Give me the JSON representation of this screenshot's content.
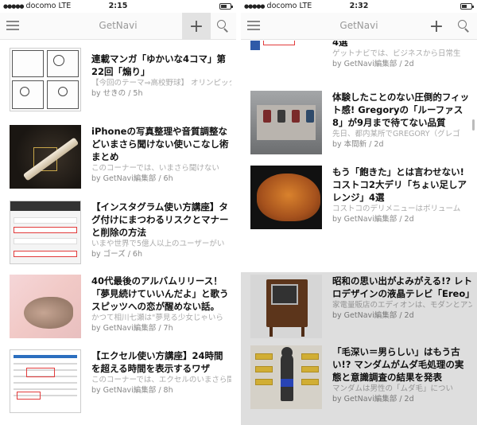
{
  "left": {
    "status": {
      "carrier": "docomo",
      "network": "LTE",
      "time": "2:15",
      "battery_level": 0.55
    },
    "nav": {
      "title": "GetNavi",
      "plus_label": "+"
    },
    "articles": [
      {
        "thumb": "manga-comic-thumbnail",
        "title": "連載マンガ「ゆかいな4コマ」第22回「煽り」",
        "excerpt": "【今回のテーマ⇒高校野球】 オリンピックとともに、夏の甲子園が終わっち",
        "meta": "by せきの / 5h"
      },
      {
        "thumb": "iphone-accessory-thumbnail",
        "title": "iPhoneの写真整理や音質調整などいまさら聞けない使いこなし術まとめ",
        "excerpt": "このコーナーでは、いまさら聞けない",
        "meta": "by GetNavi編集部 / 6h"
      },
      {
        "thumb": "instagram-settings-thumbnail",
        "title": "【インスタグラム使い方講座】タグ付けにまつわるリスクとマナーと削除の方法",
        "excerpt": "いまや世界で5億人以上のユーザーがい",
        "meta": "by ゴーズ / 6h"
      },
      {
        "thumb": "spitz-album-thumbnail",
        "title": "40代最後のアルバムリリース！「夢見続けていいんだよ」と歌うスピッツへの恋が醒めない話。",
        "excerpt": "かつて相川七瀬は\"夢見る少女じゃいら",
        "meta": "by GetNavi編集部 / 7h"
      },
      {
        "thumb": "excel-window-thumbnail",
        "title": "【エクセル使い方講座】24時間を超える時間を表示するワザ",
        "excerpt": "このコーナーでは、エクセルのいまさら聞けない基本的な機能や、達人が使",
        "meta": "by GetNavi編集部 / 8h"
      }
    ]
  },
  "right": {
    "status": {
      "carrier": "docomo",
      "network": "LTE",
      "time": "2:32",
      "battery_level": 0.45
    },
    "nav": {
      "title": "GetNavi",
      "plus_label": "+"
    },
    "articles": [
      {
        "thumb": "business-ui-thumbnail",
        "title": "4選",
        "excerpt": "ゲットナビでは、ビジネスから日常生",
        "meta": "by GetNavi編集部 / 2d"
      },
      {
        "thumb": "gregory-store-thumbnail",
        "title": "体験したことのない圧倒的フィット感! Gregoryの「ルーファス8」が9月まで待てない品質",
        "excerpt": "先日、都内某所でGREGORY（グレゴ",
        "meta": "by 本間新 / 2d"
      },
      {
        "thumb": "roast-chicken-thumbnail",
        "title": "もう「飽きた」とは言わせない! コストコ2大デリ「ちょい足しアレンジ」4選",
        "excerpt": "コストコのデリメニューはボリューム",
        "meta": "by GetNavi編集部 / 2d"
      },
      {
        "thumb": "retro-tv-thumbnail",
        "title": "昭和の思い出がよみがえる!? レトロデザインの液晶テレビ「Ereo」",
        "excerpt": "家電量販店のエディオンは、モダンとアンティークを融合させた新しい家具",
        "meta": "by GetNavi編集部 / 2d"
      },
      {
        "thumb": "body-hair-chart-thumbnail",
        "title": "「毛深い＝男らしい」はもう古い!? マンダムがムダ毛処理の実態と意識調査の結果を発表",
        "excerpt": "マンダムは男性の「ムダ毛」につい",
        "meta": "by GetNavi編集部 / 2d"
      }
    ]
  }
}
